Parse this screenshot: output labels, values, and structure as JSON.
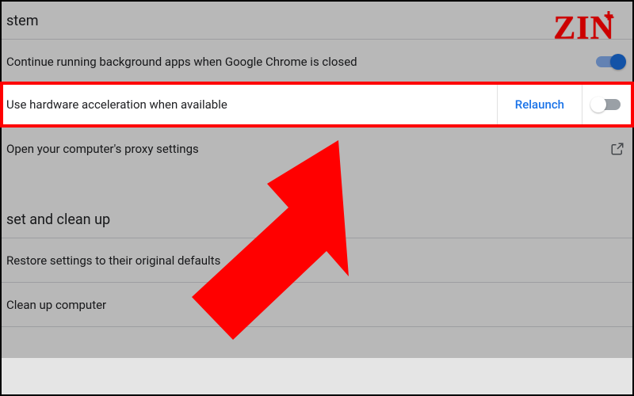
{
  "watermark": {
    "text": "ZIN",
    "plus": "+"
  },
  "sections": {
    "system": {
      "title": "stem",
      "rows": {
        "bg_apps": {
          "label": "Continue running background apps when Google Chrome is closed"
        },
        "hw_accel": {
          "label": "Use hardware acceleration when available",
          "relaunch": "Relaunch"
        },
        "proxy": {
          "label": "Open your computer's proxy settings"
        }
      }
    },
    "reset": {
      "title": "set and clean up",
      "rows": {
        "restore": {
          "label": "Restore settings to their original defaults"
        },
        "cleanup": {
          "label": "Clean up computer"
        }
      }
    }
  }
}
